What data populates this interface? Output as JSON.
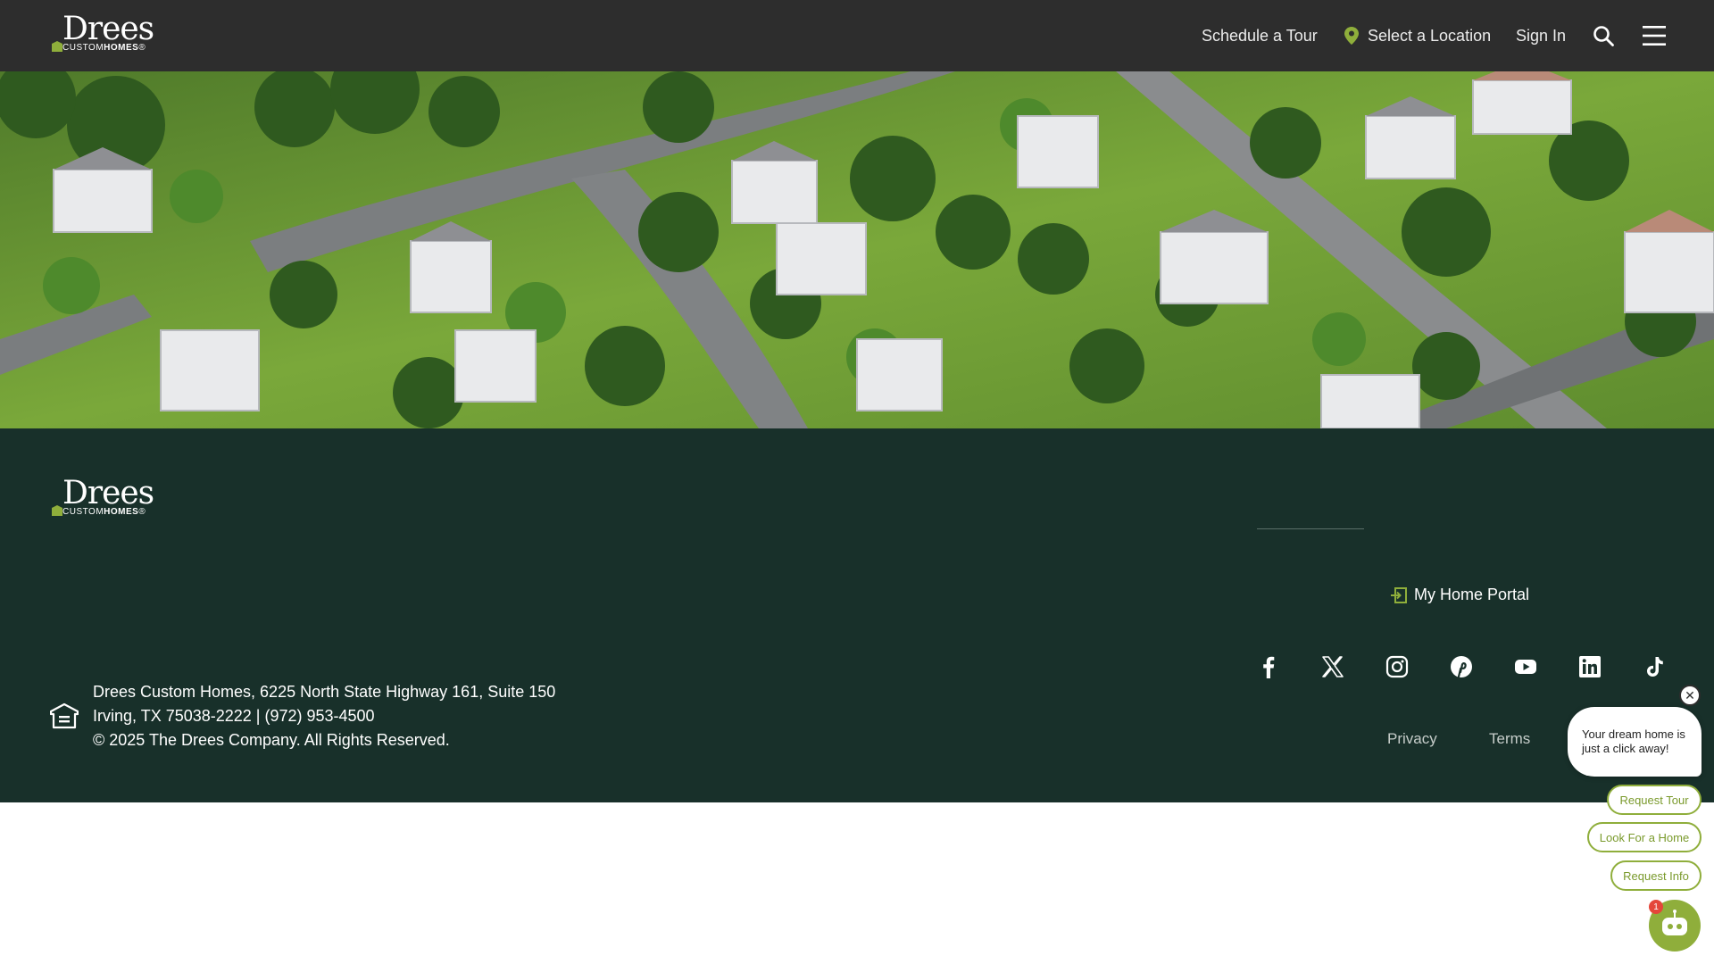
{
  "header": {
    "logo_word": "Drees",
    "logo_sub_light": "CUSTOM",
    "logo_sub_bold": "HOMES",
    "schedule_tour": "Schedule a Tour",
    "select_location": "Select a Location",
    "sign_in": "Sign In",
    "icons": {
      "location": "location-pin-icon",
      "search": "search-icon",
      "menu": "hamburger-menu-icon"
    }
  },
  "hero": {
    "description_icon": "aerial-neighborhood-photo"
  },
  "footer": {
    "logo_word": "Drees",
    "logo_sub_light": "CUSTOM",
    "logo_sub_bold": "HOMES",
    "portal_label": "My Home Portal",
    "address_line1": "Drees Custom Homes, 6225 North State Highway 161, Suite 150",
    "address_line2": "Irving, TX 75038-2222 | (972) 953-4500",
    "copyright": "© 2025 The Drees Company. All Rights Reserved.",
    "privacy": "Privacy",
    "terms": "Terms",
    "socials": [
      "facebook-icon",
      "x-icon",
      "instagram-icon",
      "pinterest-icon",
      "youtube-icon",
      "linkedin-icon",
      "tiktok-icon"
    ]
  },
  "chat": {
    "bubble_text": "Your dream home is just a click away!",
    "request_tour": "Request Tour",
    "look_for_home": "Look For a Home",
    "request_info": "Request Info",
    "badge_count": "1"
  },
  "colors": {
    "header_bg": "#2d2d2d",
    "footer_bg": "#18302a",
    "accent_green": "#8fae3b",
    "badge_red": "#e4463a"
  }
}
